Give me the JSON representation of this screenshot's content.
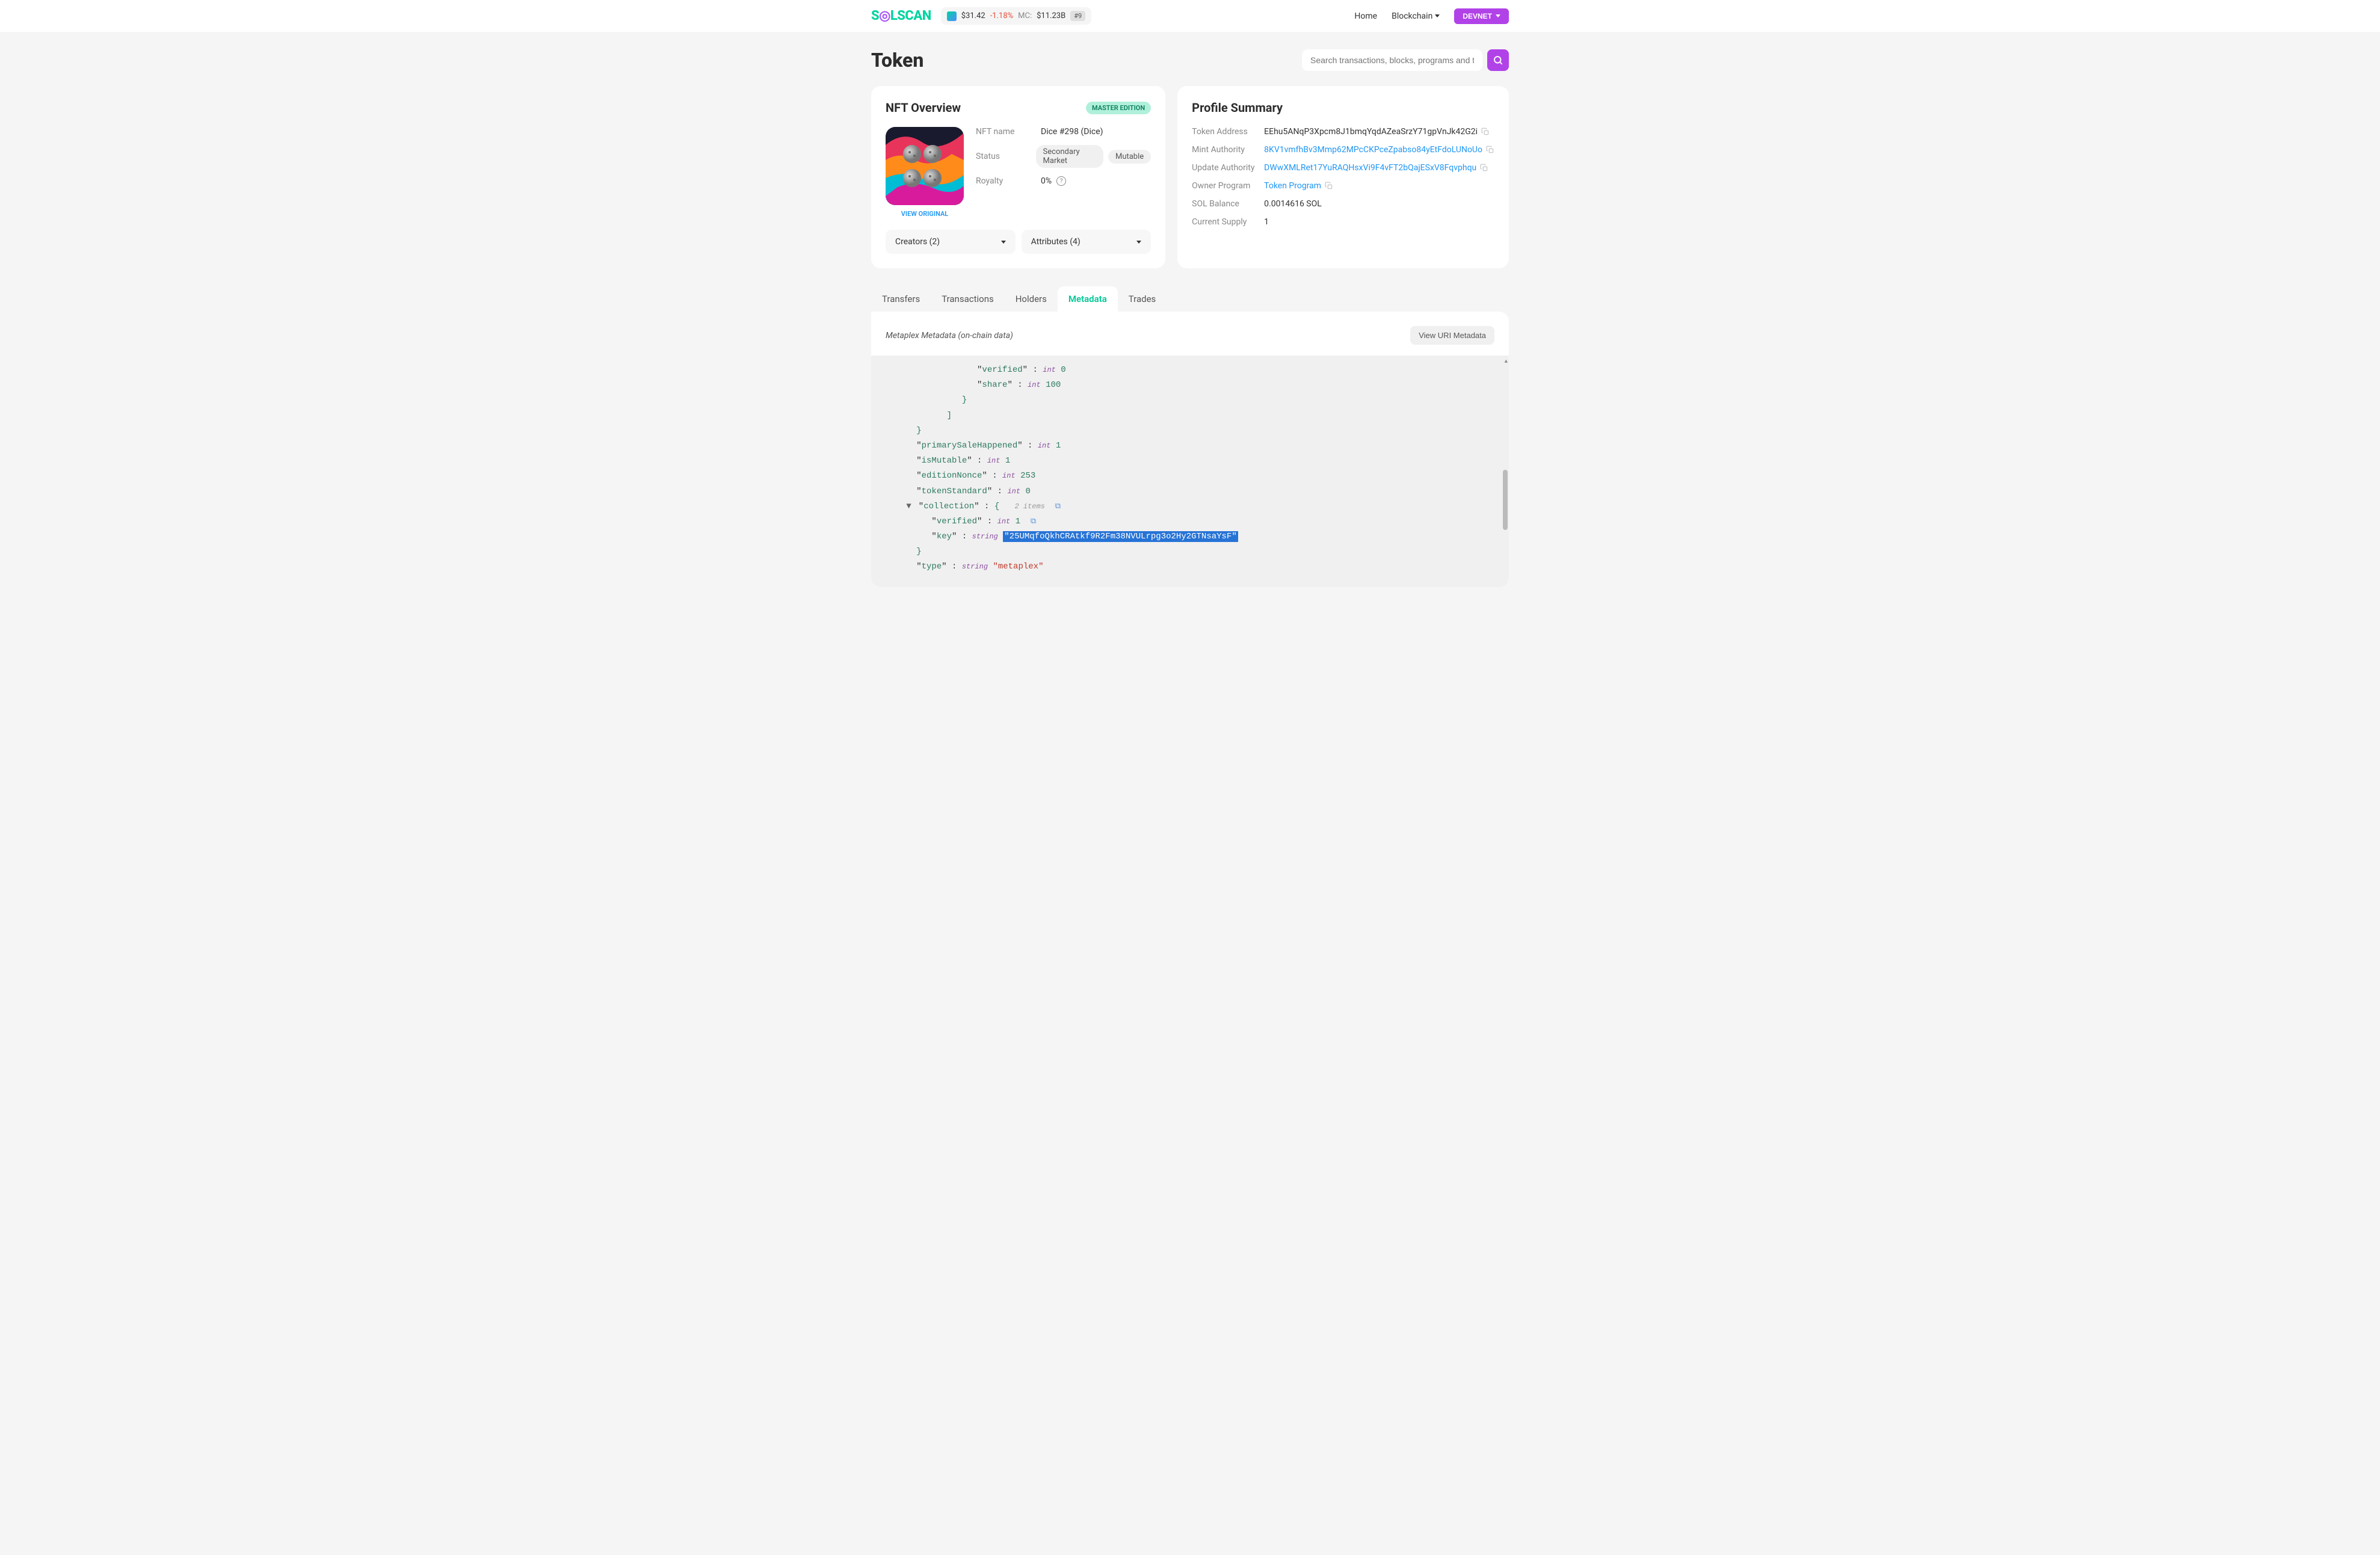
{
  "header": {
    "logo_text": "SOLSCAN",
    "price": "$31.42",
    "price_change": "-1.18%",
    "mc_label": "MC:",
    "mc_value": "$11.23B",
    "rank": "#9",
    "nav_home": "Home",
    "nav_blockchain": "Blockchain",
    "network_btn": "DEVNET"
  },
  "page": {
    "title": "Token",
    "search_placeholder": "Search transactions, blocks, programs and tokens"
  },
  "nft": {
    "card_title": "NFT Overview",
    "badge": "MASTER EDITION",
    "view_original": "VIEW ORIGINAL",
    "labels": {
      "name": "NFT name",
      "status": "Status",
      "royalty": "Royalty"
    },
    "name": "Dice #298 (Dice)",
    "status_pill1": "Secondary Market",
    "status_pill2": "Mutable",
    "royalty": "0%",
    "creators_label": "Creators (2)",
    "attributes_label": "Attributes (4)"
  },
  "profile": {
    "card_title": "Profile Summary",
    "labels": {
      "token_address": "Token Address",
      "mint_authority": "Mint Authority",
      "update_authority": "Update Authority",
      "owner_program": "Owner Program",
      "sol_balance": "SOL Balance",
      "current_supply": "Current Supply"
    },
    "token_address": "EEhu5ANqP3Xpcm8J1bmqYqdAZeaSrzY71gpVnJk42G2i",
    "mint_authority": "8KV1vmfhBv3Mmp62MPcCKPceZpabso84yEtFdoLUNoUo",
    "update_authority": "DWwXMLRet17YuRAQHsxVi9F4vFT2bQajESxV8Fqvphqu",
    "owner_program": "Token Program",
    "sol_balance": "0.0014616 SOL",
    "current_supply": "1"
  },
  "tabs": {
    "transfers": "Transfers",
    "transactions": "Transactions",
    "holders": "Holders",
    "metadata": "Metadata",
    "trades": "Trades"
  },
  "metadata": {
    "title": "Metaplex Metadata (on-chain data)",
    "view_uri_btn": "View URI Metadata",
    "json": {
      "verified": "verified",
      "verified_val": "0",
      "share": "share",
      "share_val": "100",
      "primarySaleHappened": "primarySaleHappened",
      "primarySaleHappened_val": "1",
      "isMutable": "isMutable",
      "isMutable_val": "1",
      "editionNonce": "editionNonce",
      "editionNonce_val": "253",
      "tokenStandard": "tokenStandard",
      "tokenStandard_val": "0",
      "collection": "collection",
      "collection_items": "2 items",
      "coll_verified": "verified",
      "coll_verified_val": "1",
      "coll_key": "key",
      "coll_key_val": "\"25UMqfoQkhCRAtkf9R2Fm38NVULrpg3o2Hy2GTNsaYsF\"",
      "type": "type",
      "type_val": "\"metaplex\"",
      "int_label": "int",
      "string_label": "string"
    }
  }
}
